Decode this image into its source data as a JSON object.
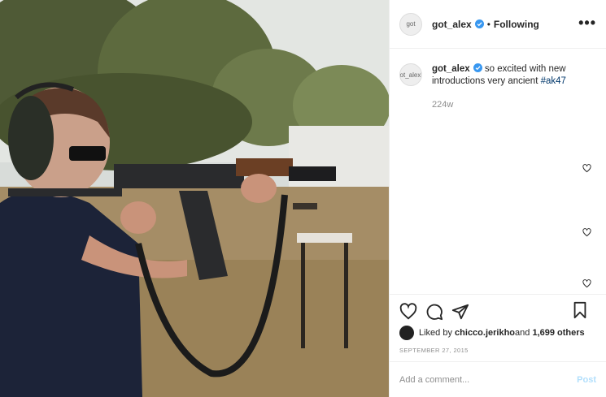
{
  "header": {
    "avatar_alt": "got",
    "username": "got_alex",
    "separator": "•",
    "follow_status": "Following",
    "more_label": "•••"
  },
  "caption": {
    "avatar_alt": "got_alex's",
    "username": "got_alex",
    "text": " so excited with new introductions very ancient ",
    "hashtag": "#ak47",
    "time_ago": "224w"
  },
  "likes": {
    "prefix": "Liked by ",
    "user": "chicco.jerikho",
    "connector": " and ",
    "others": "1,699 others"
  },
  "date": "SEPTEMBER 27, 2015",
  "comment_box": {
    "placeholder": "Add a comment...",
    "post_label": "Post"
  },
  "colors": {
    "verified": "#3897f0",
    "link": "#00376b",
    "post_disabled": "#b2dffc"
  }
}
